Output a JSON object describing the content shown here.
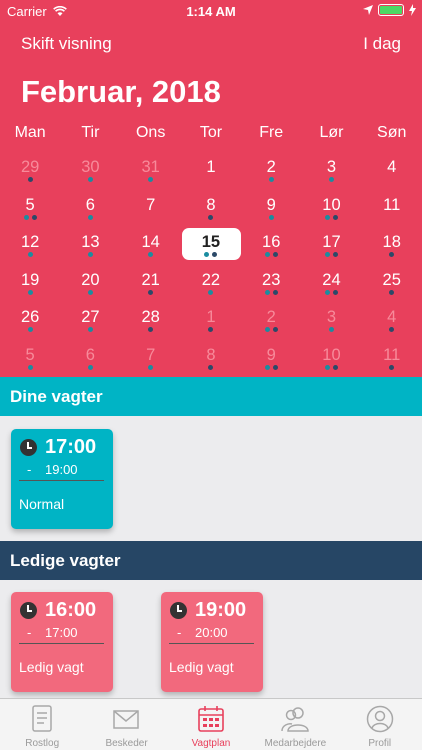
{
  "status": {
    "carrier": "Carrier",
    "time": "1:14 AM"
  },
  "header": {
    "left_button": "Skift visning",
    "right_button": "I dag",
    "month": "Februar, 2018"
  },
  "weekdays": [
    "Man",
    "Tir",
    "Ons",
    "Tor",
    "Fre",
    "Lør",
    "Søn"
  ],
  "calendar": [
    [
      {
        "d": "29",
        "o": true,
        "dots": [
          "navy"
        ]
      },
      {
        "d": "30",
        "o": true,
        "dots": [
          "teal"
        ]
      },
      {
        "d": "31",
        "o": true,
        "dots": [
          "teal"
        ]
      },
      {
        "d": "1",
        "o": false,
        "dots": []
      },
      {
        "d": "2",
        "o": false,
        "dots": [
          "teal"
        ]
      },
      {
        "d": "3",
        "o": false,
        "dots": [
          "teal"
        ]
      },
      {
        "d": "4",
        "o": false,
        "dots": []
      }
    ],
    [
      {
        "d": "5",
        "o": false,
        "dots": [
          "teal",
          "navy"
        ]
      },
      {
        "d": "6",
        "o": false,
        "dots": [
          "teal"
        ]
      },
      {
        "d": "7",
        "o": false,
        "dots": []
      },
      {
        "d": "8",
        "o": false,
        "dots": [
          "navy"
        ]
      },
      {
        "d": "9",
        "o": false,
        "dots": [
          "teal"
        ]
      },
      {
        "d": "10",
        "o": false,
        "dots": [
          "teal",
          "navy"
        ]
      },
      {
        "d": "11",
        "o": false,
        "dots": []
      }
    ],
    [
      {
        "d": "12",
        "o": false,
        "dots": [
          "teal"
        ]
      },
      {
        "d": "13",
        "o": false,
        "dots": [
          "teal"
        ]
      },
      {
        "d": "14",
        "o": false,
        "dots": [
          "teal"
        ]
      },
      {
        "d": "15",
        "o": false,
        "today": true,
        "dots": [
          "teal",
          "navy"
        ]
      },
      {
        "d": "16",
        "o": false,
        "dots": [
          "teal",
          "navy"
        ]
      },
      {
        "d": "17",
        "o": false,
        "dots": [
          "teal",
          "navy"
        ]
      },
      {
        "d": "18",
        "o": false,
        "dots": [
          "navy"
        ]
      }
    ],
    [
      {
        "d": "19",
        "o": false,
        "dots": [
          "teal"
        ]
      },
      {
        "d": "20",
        "o": false,
        "dots": [
          "teal"
        ]
      },
      {
        "d": "21",
        "o": false,
        "dots": [
          "navy"
        ]
      },
      {
        "d": "22",
        "o": false,
        "dots": [
          "teal"
        ]
      },
      {
        "d": "23",
        "o": false,
        "dots": [
          "teal",
          "navy"
        ]
      },
      {
        "d": "24",
        "o": false,
        "dots": [
          "teal",
          "navy"
        ]
      },
      {
        "d": "25",
        "o": false,
        "dots": [
          "navy"
        ]
      }
    ],
    [
      {
        "d": "26",
        "o": false,
        "dots": [
          "teal"
        ]
      },
      {
        "d": "27",
        "o": false,
        "dots": [
          "teal"
        ]
      },
      {
        "d": "28",
        "o": false,
        "dots": [
          "navy"
        ]
      },
      {
        "d": "1",
        "o": true,
        "dots": [
          "navy"
        ]
      },
      {
        "d": "2",
        "o": true,
        "dots": [
          "teal",
          "navy"
        ]
      },
      {
        "d": "3",
        "o": true,
        "dots": [
          "teal"
        ]
      },
      {
        "d": "4",
        "o": true,
        "dots": [
          "navy"
        ]
      }
    ],
    [
      {
        "d": "5",
        "o": true,
        "dots": [
          "teal"
        ]
      },
      {
        "d": "6",
        "o": true,
        "dots": [
          "teal"
        ]
      },
      {
        "d": "7",
        "o": true,
        "dots": [
          "teal"
        ]
      },
      {
        "d": "8",
        "o": true,
        "dots": [
          "navy"
        ]
      },
      {
        "d": "9",
        "o": true,
        "dots": [
          "teal",
          "navy"
        ]
      },
      {
        "d": "10",
        "o": true,
        "dots": [
          "teal",
          "navy"
        ]
      },
      {
        "d": "11",
        "o": true,
        "dots": [
          "navy"
        ]
      }
    ]
  ],
  "sections": {
    "mine": "Dine vagter",
    "open": "Ledige vagter"
  },
  "my_shifts": [
    {
      "start": "17:00",
      "dash": "-",
      "end": "19:00",
      "label": "Normal"
    }
  ],
  "open_shifts": [
    {
      "start": "16:00",
      "dash": "-",
      "end": "17:00",
      "label": "Ledig  vagt"
    },
    {
      "start": "19:00",
      "dash": "-",
      "end": "20:00",
      "label": "Ledig  vagt"
    }
  ],
  "tabs": [
    {
      "label": "Rostlog",
      "icon": "document-icon",
      "active": false
    },
    {
      "label": "Beskeder",
      "icon": "envelope-icon",
      "active": false
    },
    {
      "label": "Vagtplan",
      "icon": "calendar-icon",
      "active": true
    },
    {
      "label": "Medarbejdere",
      "icon": "people-icon",
      "active": false
    },
    {
      "label": "Profil",
      "icon": "profile-icon",
      "active": false
    }
  ],
  "colors": {
    "brand": "#e8405c",
    "teal": "#00b4c5",
    "navy": "#264665",
    "open_card": "#f2697d"
  }
}
